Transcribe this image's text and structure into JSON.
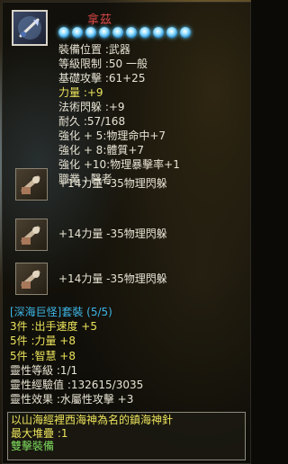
{
  "item": {
    "name": "拿茲",
    "orb_count": 10,
    "orb_color": "#4fc8f8"
  },
  "attributes": [
    {
      "text": "裝備位置 :武器",
      "color": "white"
    },
    {
      "text": "等級限制 :50   一般",
      "color": "white"
    },
    {
      "text": "基礎攻擊 :61+25",
      "color": "white"
    },
    {
      "text": "力量 :+9",
      "color": "yellow"
    },
    {
      "text": "法術閃躲 :+9",
      "color": "white"
    },
    {
      "text": "耐久 :57/168",
      "color": "white"
    },
    {
      "text": "強化 + 5:物理命中+7",
      "color": "white"
    },
    {
      "text": "強化 + 8:體質+7",
      "color": "white"
    },
    {
      "text": "強化 +10:物理暴擊率+1",
      "color": "white"
    },
    {
      "text": "職業 : 醫者",
      "color": "white"
    }
  ],
  "gems": [
    {
      "text": "+14力量 -35物理閃躲",
      "icon": "mortar-gem-icon"
    },
    {
      "text": "+14力量 -35物理閃躲",
      "icon": "mortar-gem-icon"
    },
    {
      "text": "+14力量 -35物理閃躲",
      "icon": "mortar-gem-icon"
    }
  ],
  "set": {
    "title": "[深海巨怪]套裝 (5/5)",
    "bonuses": [
      {
        "text": "3件 :出手速度 +5"
      },
      {
        "text": "5件 :力量 +8"
      },
      {
        "text": "5件 :智慧 +8"
      }
    ]
  },
  "spirit": [
    {
      "text": "靈性等級 :1/1"
    },
    {
      "text": "靈性經驗值 :132615/3035"
    },
    {
      "text": "靈性效果 :水屬性攻擊 +3"
    }
  ],
  "description": {
    "lines": [
      "以山海經裡西海神為名的鎮海神針",
      "最大堆疊 :1"
    ],
    "status": "雙擊裝備"
  },
  "colors": {
    "name": "#d84848",
    "yellow": "#ece45c",
    "green": "#7fdc5e",
    "blue": "#3db7e8"
  }
}
